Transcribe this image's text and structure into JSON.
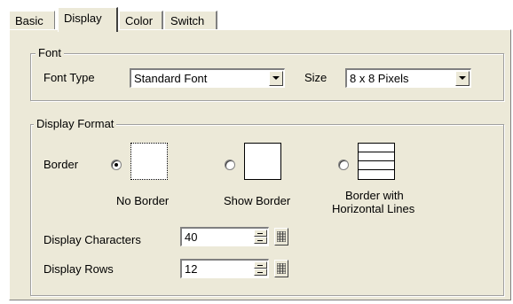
{
  "tabs": [
    {
      "label": "Basic"
    },
    {
      "label": "Display",
      "active": true
    },
    {
      "label": "Color"
    },
    {
      "label": "Switch"
    }
  ],
  "font_group": {
    "legend": "Font",
    "font_type_label": "Font Type",
    "font_type_value": "Standard Font",
    "size_label": "Size",
    "size_value": "8 x 8 Pixels"
  },
  "display_format": {
    "legend": "Display Format",
    "border_label": "Border",
    "options": [
      {
        "label": "No Border",
        "selected": true
      },
      {
        "label": "Show Border",
        "selected": false
      },
      {
        "label_line1": "Border with",
        "label_line2": "Horizontal Lines",
        "selected": false
      }
    ],
    "display_characters_label": "Display Characters",
    "display_characters_value": "40",
    "display_rows_label": "Display Rows",
    "display_rows_value": "12"
  },
  "colors": {
    "face": "#ece9d8",
    "shadow": "#808080",
    "highlight": "#ffffff"
  }
}
